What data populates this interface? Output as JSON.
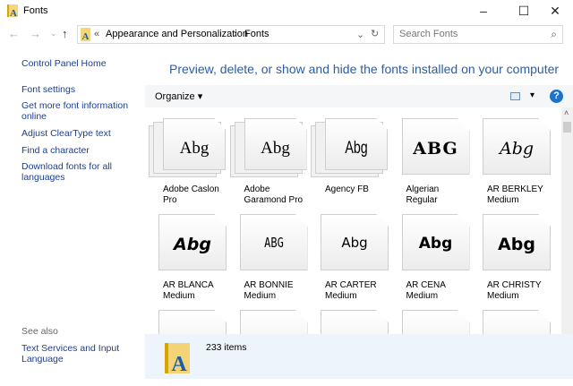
{
  "window": {
    "title": "Fonts",
    "minimize": "–",
    "maximize": "☐",
    "close": "✕"
  },
  "nav": {
    "back": "←",
    "forward": "→",
    "recent": "⌄",
    "up": "↑"
  },
  "address": {
    "chevron": "«",
    "crumbs": [
      "Appearance and Personalization",
      "Fonts"
    ],
    "sep": "›",
    "dropdown": "⌄",
    "refresh": "↻"
  },
  "search": {
    "placeholder": "Search Fonts",
    "icon": "⌕"
  },
  "sidebar": {
    "links": [
      "Control Panel Home",
      "Font settings",
      "Get more font information online",
      "Adjust ClearType text",
      "Find a character",
      "Download fonts for all languages"
    ],
    "see_also": "See also",
    "see_also_links": [
      "Text Services and Input Language"
    ]
  },
  "heading": "Preview, delete, or show and hide the fonts installed on your computer",
  "toolbar": {
    "organize": "Organize ▾",
    "view": "▾",
    "help": "?"
  },
  "fonts": [
    {
      "name": "Adobe Caslon Pro",
      "sample": "Abg",
      "stacked": true
    },
    {
      "name": "Adobe Garamond Pro",
      "sample": "Abg",
      "stacked": true
    },
    {
      "name": "Agency FB",
      "sample": "Abg",
      "stacked": true
    },
    {
      "name": "Algerian Regular",
      "sample": "ABG",
      "stacked": false
    },
    {
      "name": "AR BERKLEY Medium",
      "sample": "Abg",
      "stacked": false
    },
    {
      "name": "AR BLANCA Medium",
      "sample": "Abg",
      "stacked": false
    },
    {
      "name": "AR BONNIE Medium",
      "sample": "ABG",
      "stacked": false
    },
    {
      "name": "AR CARTER Medium",
      "sample": "Abg",
      "stacked": false
    },
    {
      "name": "AR CENA Medium",
      "sample": "Abg",
      "stacked": false
    },
    {
      "name": "AR CHRISTY Medium",
      "sample": "Abg",
      "stacked": false
    }
  ],
  "status": {
    "count": "233 items"
  }
}
